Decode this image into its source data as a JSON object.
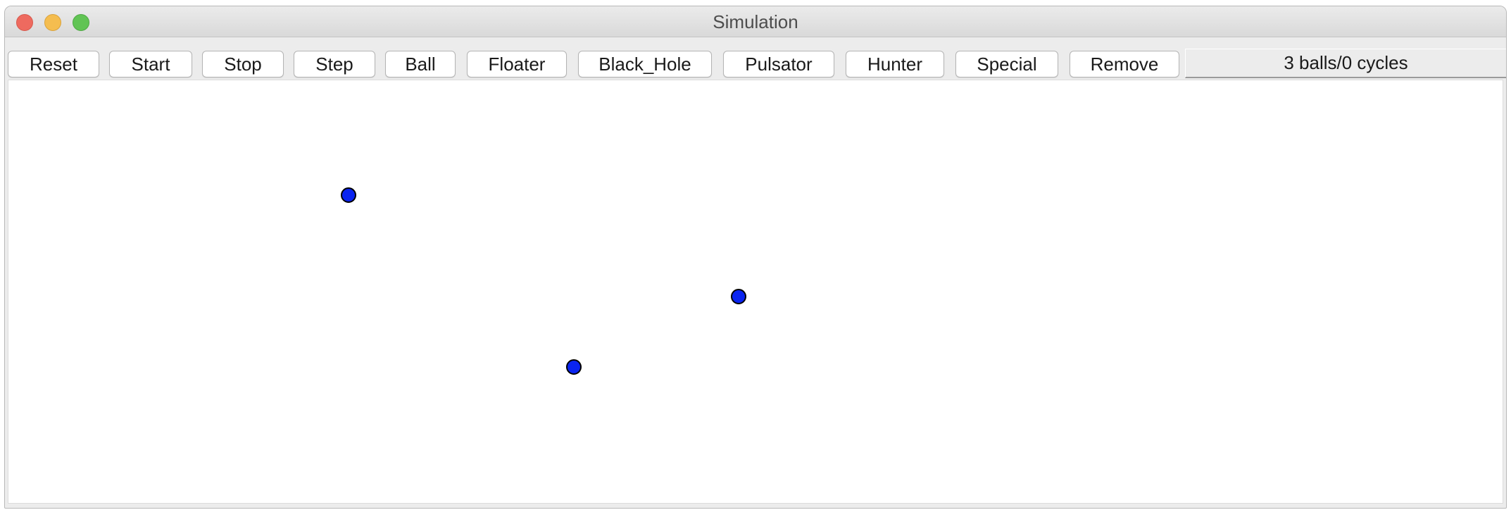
{
  "window": {
    "title": "Simulation"
  },
  "toolbar": {
    "buttons": {
      "reset": "Reset",
      "start": "Start",
      "stop": "Stop",
      "step": "Step",
      "ball": "Ball",
      "floater": "Floater",
      "black_hole": "Black_Hole",
      "pulsator": "Pulsator",
      "hunter": "Hunter",
      "special": "Special",
      "remove": "Remove"
    },
    "status": "3 balls/0 cycles"
  },
  "simulation": {
    "ball_color": "#0a24f0",
    "ball_outline_color": "#000000",
    "balls_shown": 3
  },
  "colors": {
    "close": "#ee6a5f",
    "minimize": "#f5bd4f",
    "maximize": "#61c454"
  }
}
